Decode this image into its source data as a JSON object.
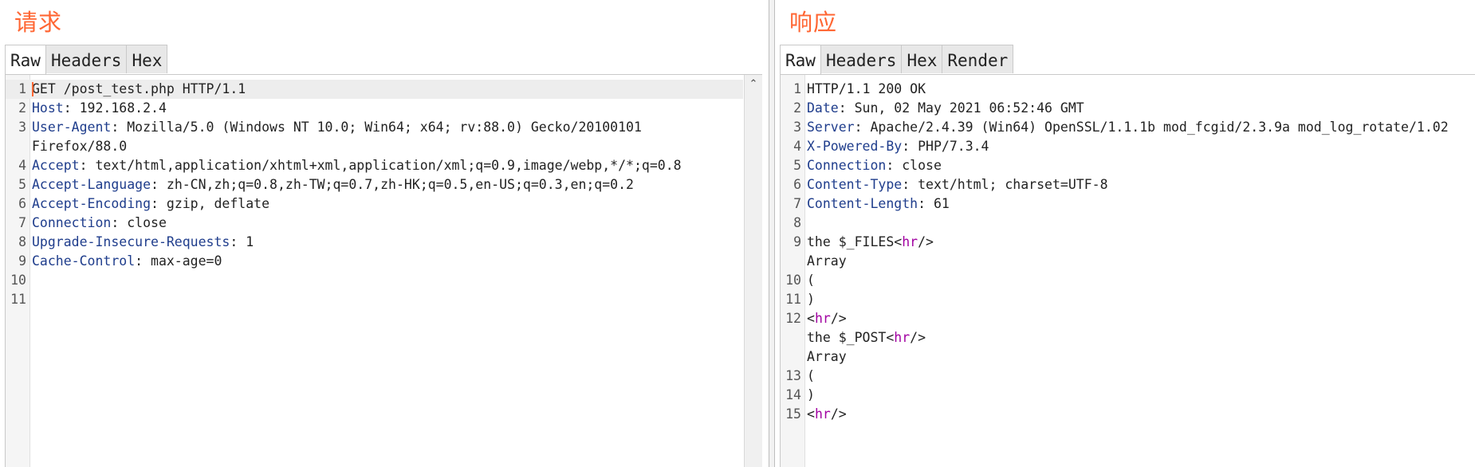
{
  "request": {
    "title": "请求",
    "tabs": [
      "Raw",
      "Headers",
      "Hex"
    ],
    "active_tab": "Raw",
    "lines": [
      {
        "n": "1",
        "key": "",
        "rest": "GET /post_test.php HTTP/1.1"
      },
      {
        "n": "2",
        "key": "Host",
        "rest": ": 192.168.2.4"
      },
      {
        "n": "3",
        "key": "User-Agent",
        "rest": ": Mozilla/5.0 (Windows NT 10.0; Win64; x64; rv:88.0) Gecko/20100101"
      },
      {
        "n": "",
        "key": "",
        "rest": "Firefox/88.0"
      },
      {
        "n": "4",
        "key": "Accept",
        "rest": ": text/html,application/xhtml+xml,application/xml;q=0.9,image/webp,*/*;q=0.8"
      },
      {
        "n": "5",
        "key": "Accept-Language",
        "rest": ": zh-CN,zh;q=0.8,zh-TW;q=0.7,zh-HK;q=0.5,en-US;q=0.3,en;q=0.2"
      },
      {
        "n": "6",
        "key": "Accept-Encoding",
        "rest": ": gzip, deflate"
      },
      {
        "n": "7",
        "key": "Connection",
        "rest": ": close"
      },
      {
        "n": "8",
        "key": "Upgrade-Insecure-Requests",
        "rest": ": 1"
      },
      {
        "n": "9",
        "key": "Cache-Control",
        "rest": ": max-age=0"
      },
      {
        "n": "10",
        "key": "",
        "rest": ""
      },
      {
        "n": "11",
        "key": "",
        "rest": ""
      }
    ]
  },
  "response": {
    "title": "响应",
    "tabs": [
      "Raw",
      "Headers",
      "Hex",
      "Render"
    ],
    "active_tab": "Raw",
    "lines": [
      {
        "n": "1",
        "key": "",
        "rest": "HTTP/1.1 200 OK"
      },
      {
        "n": "2",
        "key": "Date",
        "rest": ": Sun, 02 May 2021 06:52:46 GMT"
      },
      {
        "n": "3",
        "key": "Server",
        "rest": ": Apache/2.4.39 (Win64) OpenSSL/1.1.1b mod_fcgid/2.3.9a mod_log_rotate/1.02"
      },
      {
        "n": "4",
        "key": "X-Powered-By",
        "rest": ": PHP/7.3.4"
      },
      {
        "n": "5",
        "key": "Connection",
        "rest": ": close"
      },
      {
        "n": "6",
        "key": "Content-Type",
        "rest": ": text/html; charset=UTF-8"
      },
      {
        "n": "7",
        "key": "Content-Length",
        "rest": ": 61"
      },
      {
        "n": "8",
        "key": "",
        "rest": ""
      },
      {
        "n": "9",
        "pre": "the $_FILES<",
        "tag": "hr",
        "post": "/>"
      },
      {
        "n": "",
        "key": "",
        "rest": "Array"
      },
      {
        "n": "10",
        "key": "",
        "rest": "("
      },
      {
        "n": "11",
        "key": "",
        "rest": ")"
      },
      {
        "n": "12",
        "pre": "<",
        "tag": "hr",
        "post": "/>"
      },
      {
        "n": "",
        "pre": "the $_POST<",
        "tag": "hr",
        "post": "/>"
      },
      {
        "n": "",
        "key": "",
        "rest": "Array"
      },
      {
        "n": "13",
        "key": "",
        "rest": "("
      },
      {
        "n": "14",
        "key": "",
        "rest": ")"
      },
      {
        "n": "15",
        "pre": "<",
        "tag": "hr",
        "post": "/>"
      }
    ]
  },
  "colors": {
    "title": "#ff6633",
    "header_key": "#1f3d8c",
    "html_tag": "#a100a1"
  },
  "icons": {
    "scroll_up": "chevron-up-icon"
  }
}
